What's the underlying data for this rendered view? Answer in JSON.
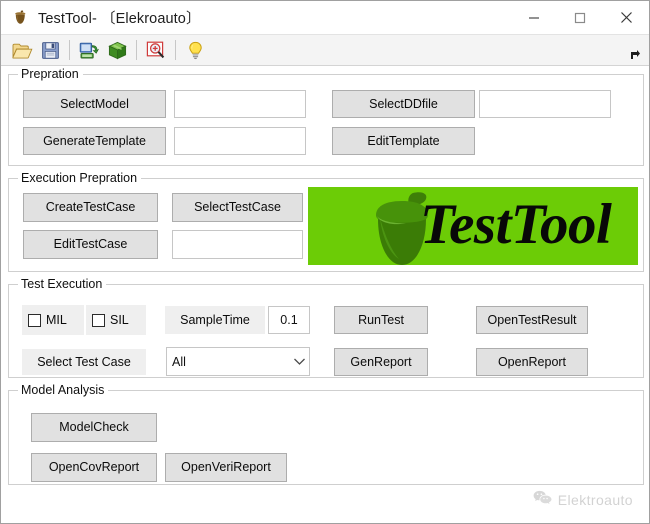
{
  "window": {
    "title": "TestTool- 〔Elekroauto〕",
    "app_icon": "acorn-icon",
    "controls": {
      "minimize": "minimize-icon",
      "maximize": "maximize-icon",
      "close": "close-icon"
    }
  },
  "toolbar": {
    "items": [
      {
        "icon": "open-folder-icon",
        "tooltip": "Open"
      },
      {
        "icon": "save-floppy-icon",
        "tooltip": "Save"
      },
      {
        "icon": "model-import-icon",
        "tooltip": "Import Model"
      },
      {
        "icon": "green-cube-icon",
        "tooltip": "Build"
      },
      {
        "icon": "zoom-in-magnifier-icon",
        "tooltip": "Zoom In"
      },
      {
        "icon": "lightbulb-icon",
        "tooltip": "Hint"
      }
    ],
    "overflow": "toolbar-overflow-icon"
  },
  "groups": {
    "prepration": {
      "title": "Prepration",
      "select_model_button": "SelectModel",
      "select_model_value": "",
      "select_ddfile_button": "SelectDDfile",
      "select_ddfile_value": "",
      "generate_template_button": "GenerateTemplate",
      "generate_template_value": "",
      "edit_template_button": "EditTemplate"
    },
    "execution_prepration": {
      "title": "Execution Prepration",
      "create_testcase_button": "CreateTestCase",
      "select_testcase_button": "SelectTestCase",
      "edit_testcase_button": "EditTestCase",
      "testcase_value": "",
      "logo_word": "TestTool",
      "logo_bg_color": "#6ccc06",
      "logo_acorn_color": "#367206"
    },
    "test_execution": {
      "title": "Test Execution",
      "mil_label": "MIL",
      "mil_checked": false,
      "sil_label": "SIL",
      "sil_checked": false,
      "sample_time_label": "SampleTime",
      "sample_time_value": "0.1",
      "run_test_button": "RunTest",
      "open_test_result_button": "OpenTestResult",
      "select_test_case_label": "Select Test Case",
      "test_case_selected": "All",
      "test_case_options": [
        "All"
      ],
      "gen_report_button": "GenReport",
      "open_report_button": "OpenReport"
    },
    "model_analysis": {
      "title": "Model Analysis",
      "model_check_button": "ModelCheck",
      "open_cov_report_button": "OpenCovReport",
      "open_veri_report_button": "OpenVeriReport"
    }
  },
  "watermark": {
    "icon": "wechat-icon",
    "text": "Elektroauto"
  }
}
